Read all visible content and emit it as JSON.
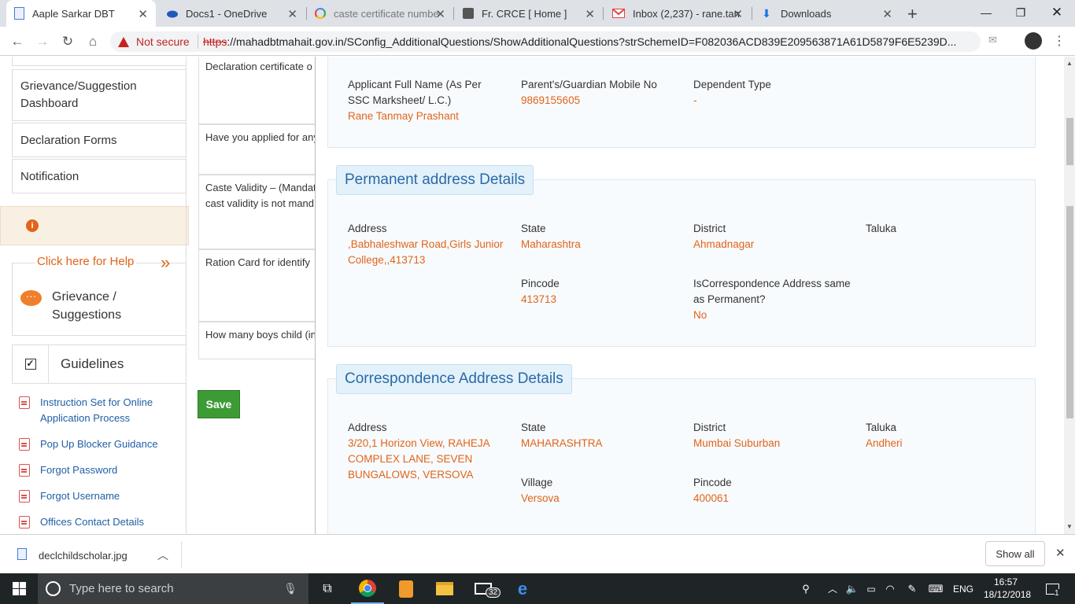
{
  "tabs": [
    {
      "title": "Aaple Sarkar DBT",
      "icon": "document-icon",
      "active": true
    },
    {
      "title": "Docs1 - OneDrive",
      "icon": "onedrive-icon"
    },
    {
      "title": "caste certificate numbe",
      "icon": "google-icon"
    },
    {
      "title": "Fr. CRCE [ Home ]",
      "icon": "college-icon"
    },
    {
      "title": "Inbox (2,237) - rane.tan",
      "icon": "gmail-icon"
    },
    {
      "title": "Downloads",
      "icon": "download-icon"
    }
  ],
  "toolbar": {
    "not_secure": "Not secure",
    "url_scheme": "https",
    "url_rest": "://mahadbtmahait.gov.in/SConfig_AdditionalQuestions/ShowAdditionalQuestions?strSchemeID=F082036ACD839E209563871A61D5879F6E5239D..."
  },
  "sidebar": {
    "menu": [
      "Grievance/Suggestion Dashboard",
      "Declaration Forms",
      "Notification"
    ],
    "help_link": "Click here for Help",
    "grievance": "Grievance / Suggestions",
    "guidelines_title": "Guidelines",
    "guideline_links": [
      "Instruction Set for Online Application Process",
      "Pop Up Blocker Guidance",
      "Forgot Password",
      "Forgot Username",
      "Offices Contact Details"
    ]
  },
  "questions": [
    "Declaration certificate o",
    "Have you applied for any",
    "Caste Validity – (Mandat",
    "cast validity is not mand",
    "Ration Card for identify",
    "How many boys child (in"
  ],
  "save_label": "Save",
  "applicant": {
    "name_label": "Applicant Full Name (As Per SSC Marksheet/ L.C.)",
    "name_value": "Rane Tanmay Prashant",
    "mobile_label": "Parent's/Guardian Mobile No",
    "mobile_value": "9869155605",
    "dependent_label": "Dependent Type",
    "dependent_value": "-"
  },
  "permanent": {
    "heading": "Permanent address Details",
    "address_label": "Address",
    "address_value": ",Babhaleshwar Road,Girls Junior College,,413713",
    "state_label": "State",
    "state_value": "Maharashtra",
    "district_label": "District",
    "district_value": "Ahmadnagar",
    "taluka_label": "Taluka",
    "pincode_label": "Pincode",
    "pincode_value": "413713",
    "same_label": "IsCorrespondence Address same as Permanent?",
    "same_value": "No"
  },
  "correspondence": {
    "heading": "Correspondence Address Details",
    "address_label": "Address",
    "address_value": "3/20,1 Horizon View, RAHEJA COMPLEX LANE, SEVEN BUNGALOWS, VERSOVA",
    "state_label": "State",
    "state_value": "MAHARASHTRA",
    "district_label": "District",
    "district_value": "Mumbai Suburban",
    "taluka_label": "Taluka",
    "taluka_value": "Andheri",
    "village_label": "Village",
    "village_value": "Versova",
    "pincode_label": "Pincode",
    "pincode_value": "400061"
  },
  "download": {
    "file": "declchildscholar.jpg",
    "show_all": "Show all"
  },
  "taskbar": {
    "search_placeholder": "Type here to search",
    "mail_badge": "32",
    "lang": "ENG",
    "time": "16:57",
    "date": "18/12/2018",
    "notif": "1"
  }
}
